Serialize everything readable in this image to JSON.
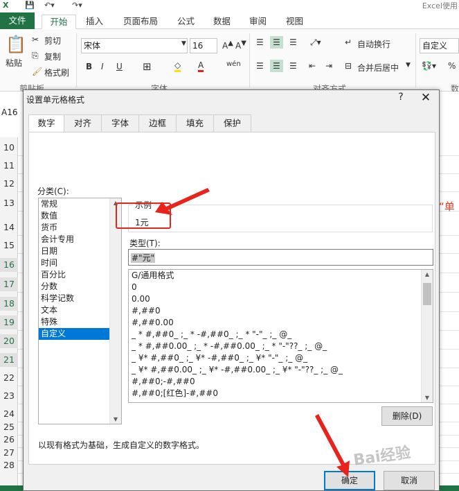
{
  "app": {
    "title": "Excel使用"
  },
  "ribbon": {
    "tabs": [
      "文件",
      "开始",
      "插入",
      "页面布局",
      "公式",
      "数据",
      "审阅",
      "视图"
    ],
    "clipboard": {
      "paste": "粘贴",
      "cut": "剪切",
      "copy": "复制",
      "format_painter": "格式刷",
      "group": "剪贴板"
    },
    "font": {
      "name": "宋体",
      "size": "16",
      "bold": "B",
      "italic": "I",
      "underline": "U",
      "group": "字体"
    },
    "alignment": {
      "wrap": "自动换行",
      "merge": "合并后居中",
      "group": "对齐方式"
    },
    "number": {
      "format": "自定义",
      "group": "数"
    }
  },
  "name_box": "A16",
  "rows": [
    "10",
    "11",
    "12",
    "13",
    "14",
    "15",
    "16",
    "17",
    "18",
    "19",
    "20",
    "21",
    "22",
    "23",
    "24",
    "25",
    "26",
    "27",
    "28"
  ],
  "side_text": "“单",
  "dialog": {
    "title": "设置单元格格式",
    "help": "?",
    "close": "✕",
    "tabs": [
      "数字",
      "对齐",
      "字体",
      "边框",
      "填充",
      "保护"
    ],
    "category_label": "分类(C):",
    "categories": [
      "常规",
      "数值",
      "货币",
      "会计专用",
      "日期",
      "时间",
      "百分比",
      "分数",
      "科学记数",
      "文本",
      "特殊",
      "自定义"
    ],
    "selected_category": "自定义",
    "sample_label": "示例",
    "sample_value": "1元",
    "type_label": "类型(T):",
    "type_value": "#\"元\"",
    "formats": [
      "G/通用格式",
      "0",
      "0.00",
      "#,##0",
      "#,##0.00",
      "_ * #,##0_ ;_ * -#,##0_ ;_ * \"-\"_ ;_ @_",
      "_ * #,##0.00_ ;_ * -#,##0.00_ ;_ * \"-\"??_ ;_ @_",
      "_ ¥* #,##0_ ;_ ¥* -#,##0_ ;_ ¥* \"-\"_ ;_ @_",
      "_ ¥* #,##0.00_ ;_ ¥* -#,##0.00_ ;_ ¥* \"-\"??_ ;_ @_",
      "#,##0;-#,##0",
      "#,##0;[红色]-#,##0"
    ],
    "delete_label": "删除(D)",
    "hint": "以现有格式为基础，生成自定义的数字格式。",
    "ok_label": "确定",
    "cancel_label": "取消"
  },
  "colors": {
    "excel_green": "#217346",
    "selection_blue": "#0078d7",
    "annotation_red": "#e8231c"
  }
}
